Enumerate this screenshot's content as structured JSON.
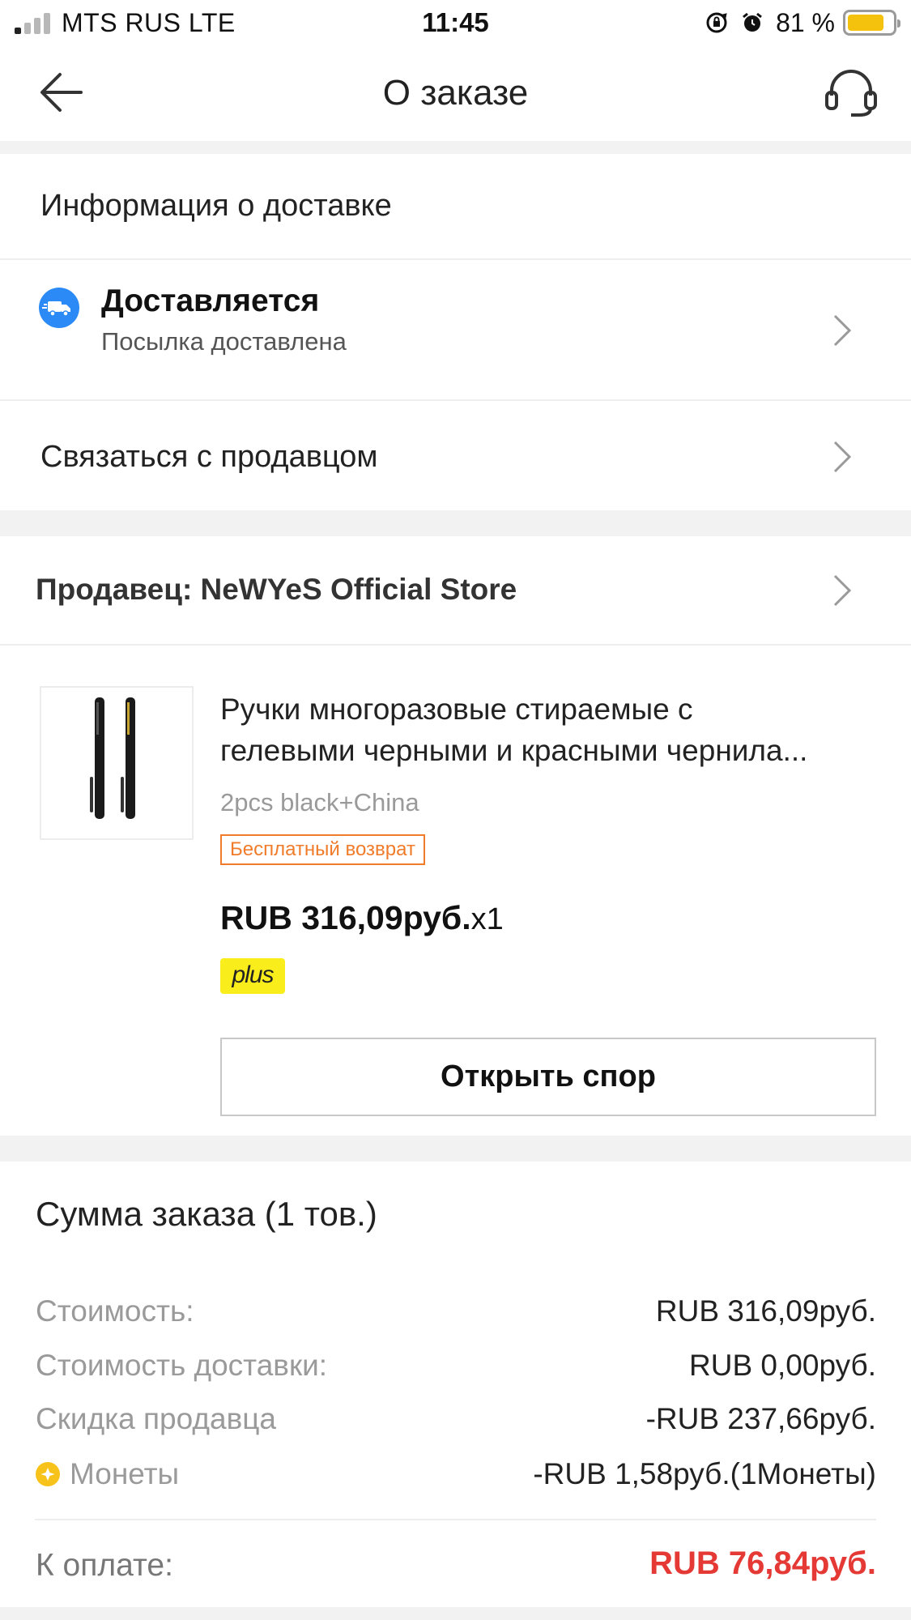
{
  "status_bar": {
    "carrier": "MTS RUS   LTE",
    "time": "11:45",
    "battery_percent": "81 %",
    "battery_level": 0.81,
    "signal_bars_filled": 1,
    "icons": [
      "rotation-lock-icon",
      "alarm-icon",
      "battery-icon"
    ]
  },
  "header": {
    "title": "О заказе",
    "back_icon": "arrow-left-icon",
    "support_icon": "headset-icon"
  },
  "delivery_info": {
    "section_title": "Информация о доставке",
    "status": "Доставляется",
    "status_sub": "Посылка доставлена",
    "status_icon": "truck-icon",
    "status_icon_color": "#2b8af5"
  },
  "contact": {
    "label": "Связаться с продавцом"
  },
  "seller": {
    "label": "Продавец: NeWYeS Official Store"
  },
  "product": {
    "title_line1": "Ручки многоразовые стираемые с",
    "title_line2": "гелевыми черными и красными чернила...",
    "variant": "2pcs black+China",
    "return_badge": "Бесплатный возврат",
    "price": "RUB 316,09руб.",
    "quantity": "x1",
    "plus_badge": "plus",
    "dispute_button": "Открыть спор"
  },
  "summary": {
    "title": "Сумма заказа (1 тов.)",
    "rows": [
      {
        "label": "Стоимость:",
        "value": "RUB 316,09руб."
      },
      {
        "label": "Стоимость доставки:",
        "value": "RUB 0,00руб."
      },
      {
        "label": "Скидка продавца",
        "value": "-RUB 237,66руб."
      },
      {
        "label": "Монеты",
        "value": "-RUB 1,58руб.(1Монеты)"
      }
    ],
    "total_label": "К оплате:",
    "total_value": "RUB 76,84руб.",
    "total_color": "#e53935"
  }
}
